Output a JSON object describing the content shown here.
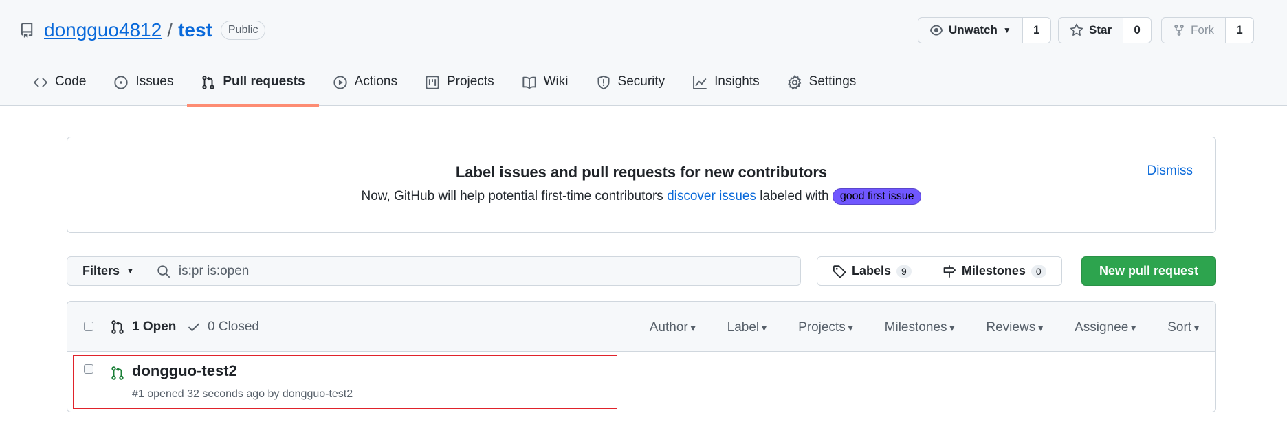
{
  "repo": {
    "owner": "dongguo4812",
    "separator": "/",
    "name": "test",
    "visibility": "Public"
  },
  "actions": {
    "watch": {
      "label": "Unwatch",
      "count": "1"
    },
    "star": {
      "label": "Star",
      "count": "0"
    },
    "fork": {
      "label": "Fork",
      "count": "1"
    }
  },
  "tabs": [
    {
      "label": "Code",
      "icon": "code-icon"
    },
    {
      "label": "Issues",
      "icon": "issue-icon"
    },
    {
      "label": "Pull requests",
      "icon": "pull-request-icon",
      "active": true
    },
    {
      "label": "Actions",
      "icon": "play-icon"
    },
    {
      "label": "Projects",
      "icon": "project-icon"
    },
    {
      "label": "Wiki",
      "icon": "book-icon"
    },
    {
      "label": "Security",
      "icon": "shield-icon"
    },
    {
      "label": "Insights",
      "icon": "graph-icon"
    },
    {
      "label": "Settings",
      "icon": "gear-icon"
    }
  ],
  "banner": {
    "title": "Label issues and pull requests for new contributors",
    "text_before": "Now, GitHub will help potential first-time contributors ",
    "link": "discover issues",
    "text_after": " labeled with ",
    "label": "good first issue",
    "label_color": "#7057ff",
    "dismiss": "Dismiss"
  },
  "filter": {
    "filters_label": "Filters",
    "search_value": "is:pr is:open"
  },
  "labels_button": {
    "label": "Labels",
    "count": "9"
  },
  "milestones_button": {
    "label": "Milestones",
    "count": "0"
  },
  "new_pr_button": "New pull request",
  "list": {
    "open_label": "1 Open",
    "closed_label": "0 Closed",
    "sort_options": [
      "Author",
      "Label",
      "Projects",
      "Milestones",
      "Reviews",
      "Assignee",
      "Sort"
    ],
    "items": [
      {
        "title": "dongguo-test2",
        "meta": "#1 opened 32 seconds ago by dongguo-test2"
      }
    ]
  },
  "colors": {
    "accent_link": "#0969da",
    "primary_button": "#2da44e",
    "active_tab_underline": "#fd8c73",
    "open_icon": "#1a7f37",
    "highlight_box": "#e0232b"
  }
}
